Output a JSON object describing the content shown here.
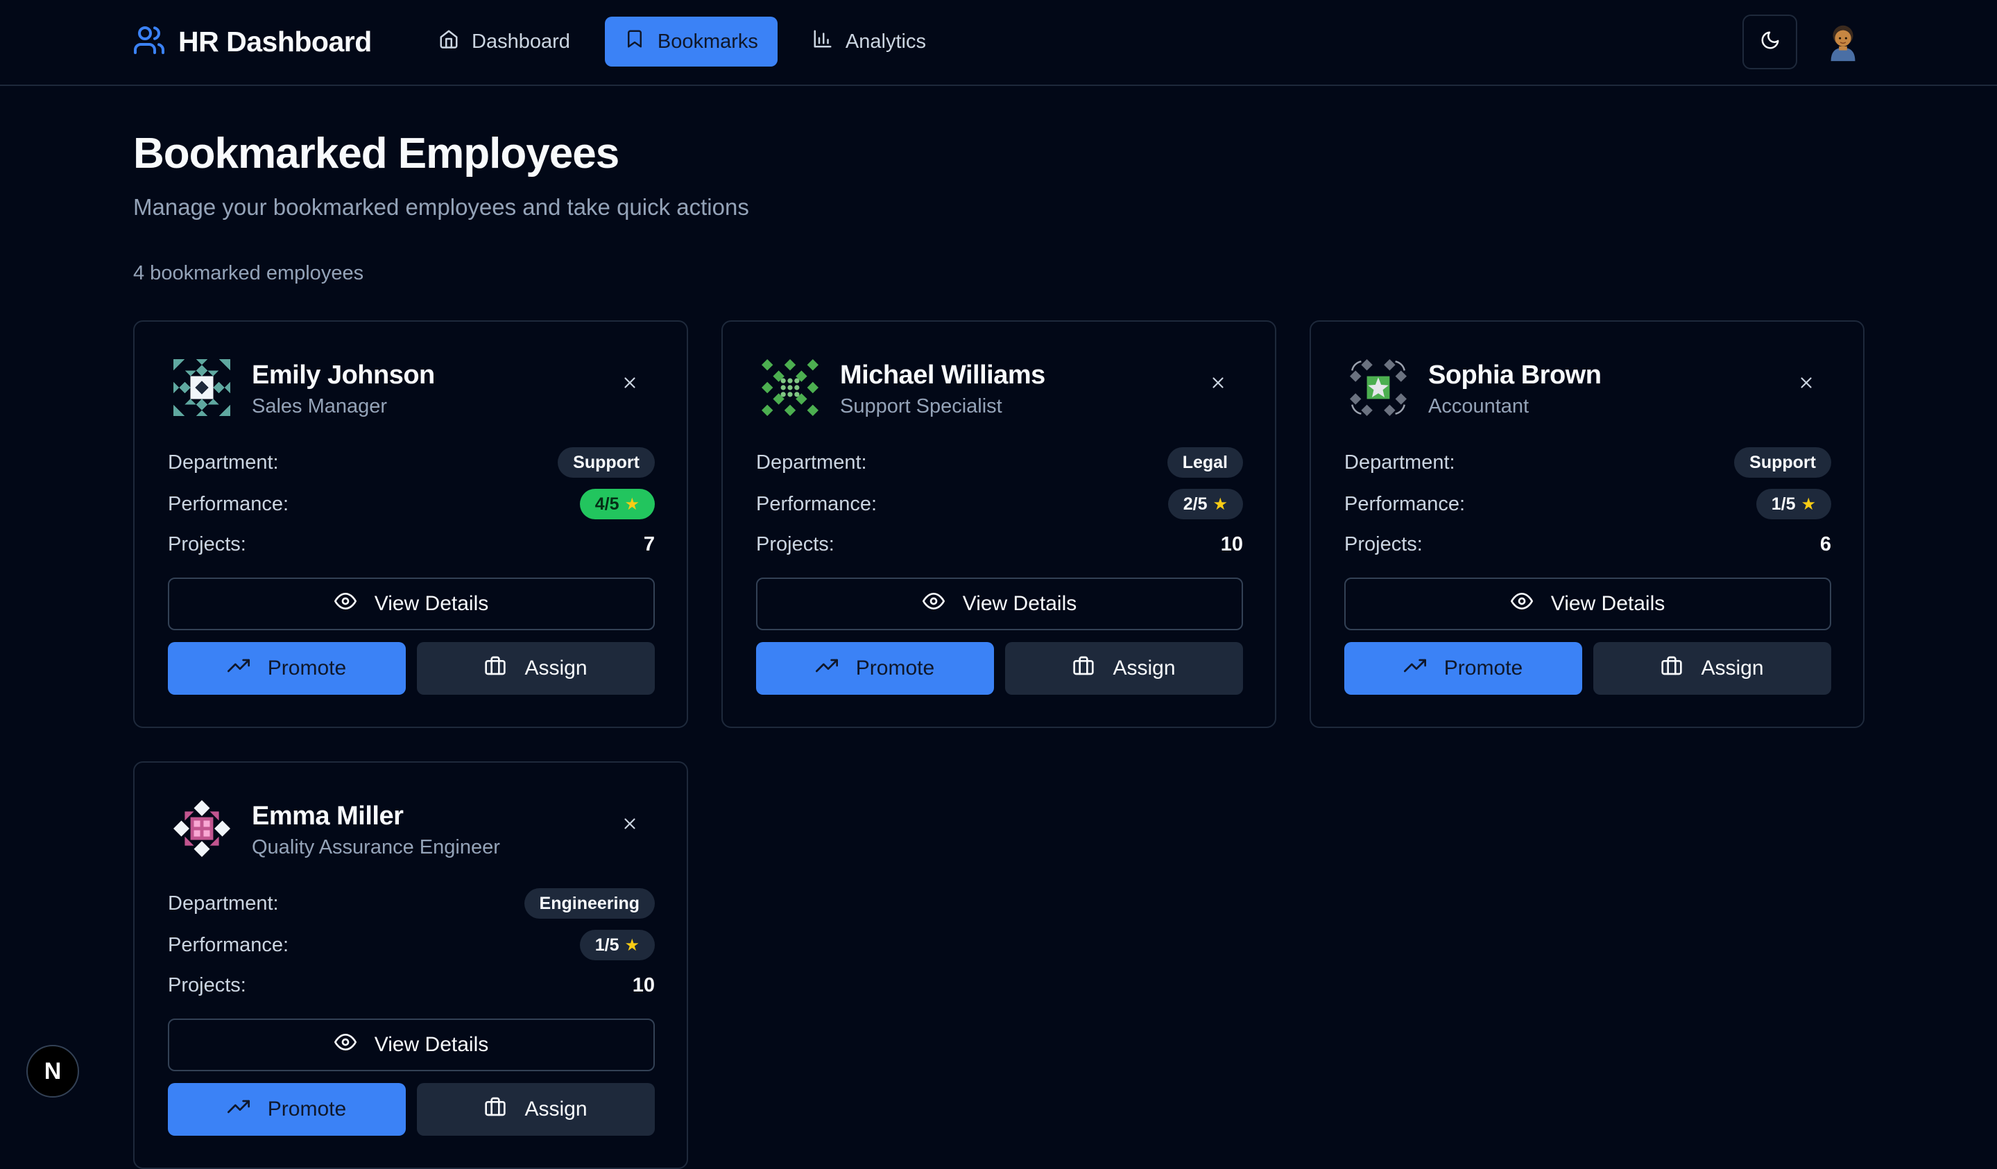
{
  "colors": {
    "background": "#020817",
    "accent": "#3b82f6",
    "border": "#1e293b",
    "success": "#22c55e",
    "star": "#facc15"
  },
  "app": {
    "title": "HR Dashboard",
    "logo_icon": "users-icon"
  },
  "nav": [
    {
      "label": "Dashboard",
      "icon": "home-icon",
      "active": false
    },
    {
      "label": "Bookmarks",
      "icon": "bookmark-icon",
      "active": true
    },
    {
      "label": "Analytics",
      "icon": "bar-chart-icon",
      "active": false
    }
  ],
  "header": {
    "theme_icon": "moon-icon",
    "avatar_icon": "user-avatar"
  },
  "page": {
    "title": "Bookmarked Employees",
    "subtitle": "Manage your bookmarked employees and take quick actions",
    "count_label": "4 bookmarked employees"
  },
  "labels": {
    "department": "Department:",
    "performance": "Performance:",
    "projects": "Projects:",
    "view_details": "View Details",
    "promote": "Promote",
    "assign": "Assign"
  },
  "employees": [
    {
      "name": "Emily Johnson",
      "role": "Sales Manager",
      "department": "Support",
      "performance": "4/5",
      "rating": 4,
      "projects": "7"
    },
    {
      "name": "Michael Williams",
      "role": "Support Specialist",
      "department": "Legal",
      "performance": "2/5",
      "rating": 2,
      "projects": "10"
    },
    {
      "name": "Sophia Brown",
      "role": "Accountant",
      "department": "Support",
      "performance": "1/5",
      "rating": 1,
      "projects": "6"
    },
    {
      "name": "Emma Miller",
      "role": "Quality Assurance Engineer",
      "department": "Engineering",
      "performance": "1/5",
      "rating": 1,
      "projects": "10"
    }
  ],
  "dev_badge": {
    "label": "N"
  }
}
